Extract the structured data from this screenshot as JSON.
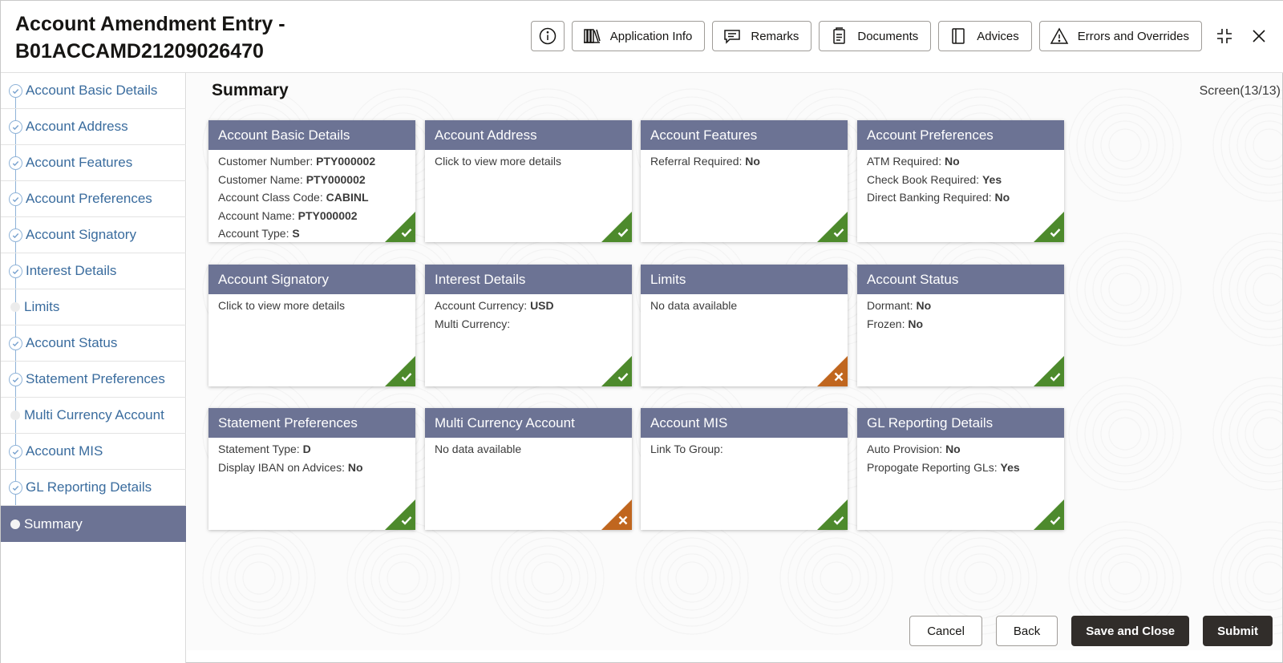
{
  "header": {
    "title_line1": "Account Amendment Entry -",
    "title_line2": "B01ACCAMD21209026470",
    "toolbar": {
      "info_icon": "info-icon",
      "application_info": "Application Info",
      "remarks": "Remarks",
      "documents": "Documents",
      "advices": "Advices",
      "errors_and_overrides": "Errors and Overrides"
    }
  },
  "sidebar": {
    "items": [
      {
        "label": "Account Basic Details",
        "status": "visited"
      },
      {
        "label": "Account Address",
        "status": "visited"
      },
      {
        "label": "Account Features",
        "status": "visited"
      },
      {
        "label": "Account Preferences",
        "status": "visited"
      },
      {
        "label": "Account Signatory",
        "status": "visited"
      },
      {
        "label": "Interest Details",
        "status": "visited"
      },
      {
        "label": "Limits",
        "status": "not-visited"
      },
      {
        "label": "Account Status",
        "status": "visited"
      },
      {
        "label": "Statement Preferences",
        "status": "visited"
      },
      {
        "label": "Multi Currency Account",
        "status": "not-visited"
      },
      {
        "label": "Account MIS",
        "status": "visited"
      },
      {
        "label": "GL Reporting Details",
        "status": "visited"
      },
      {
        "label": "Summary",
        "status": "active"
      }
    ]
  },
  "main": {
    "title": "Summary",
    "screen_indicator": "Screen(13/13)",
    "cards": [
      {
        "title": "Account Basic Details",
        "status": "ok",
        "rows": [
          {
            "label": "Customer Number: ",
            "value": "PTY000002"
          },
          {
            "label": "Customer Name: ",
            "value": "PTY000002"
          },
          {
            "label": "Account Class Code: ",
            "value": "CABINL"
          },
          {
            "label": "Account Name: ",
            "value": "PTY000002"
          },
          {
            "label": "Account Type: ",
            "value": "S"
          }
        ]
      },
      {
        "title": "Account Address",
        "status": "ok",
        "rows": [
          {
            "label": "Click to view more details",
            "value": ""
          }
        ]
      },
      {
        "title": "Account Features",
        "status": "ok",
        "rows": [
          {
            "label": "Referral Required: ",
            "value": "No"
          }
        ]
      },
      {
        "title": "Account Preferences",
        "status": "ok",
        "rows": [
          {
            "label": "ATM Required: ",
            "value": "No"
          },
          {
            "label": "Check Book Required: ",
            "value": "Yes"
          },
          {
            "label": "Direct Banking Required: ",
            "value": "No"
          }
        ]
      },
      {
        "title": "Account Signatory",
        "status": "ok",
        "rows": [
          {
            "label": "Click to view more details",
            "value": ""
          }
        ]
      },
      {
        "title": "Interest Details",
        "status": "ok",
        "rows": [
          {
            "label": "Account Currency: ",
            "value": "USD"
          },
          {
            "label": "Multi Currency: ",
            "value": ""
          }
        ]
      },
      {
        "title": "Limits",
        "status": "error",
        "rows": [
          {
            "label": "No data available",
            "value": ""
          }
        ]
      },
      {
        "title": "Account Status",
        "status": "ok",
        "rows": [
          {
            "label": "Dormant: ",
            "value": "No"
          },
          {
            "label": "Frozen: ",
            "value": "No"
          }
        ]
      },
      {
        "title": "Statement Preferences",
        "status": "ok",
        "rows": [
          {
            "label": "Statement Type: ",
            "value": "D"
          },
          {
            "label": "Display IBAN on Advices: ",
            "value": "No"
          }
        ]
      },
      {
        "title": "Multi Currency Account",
        "status": "error",
        "rows": [
          {
            "label": "No data available",
            "value": ""
          }
        ]
      },
      {
        "title": "Account MIS",
        "status": "ok",
        "rows": [
          {
            "label": "Link To Group: ",
            "value": ""
          }
        ]
      },
      {
        "title": "GL Reporting Details",
        "status": "ok",
        "rows": [
          {
            "label": "Auto Provision: ",
            "value": "No"
          },
          {
            "label": "Propogate Reporting GLs: ",
            "value": "Yes"
          }
        ]
      }
    ]
  },
  "footer": {
    "cancel": "Cancel",
    "back": "Back",
    "save_and_close": "Save and Close",
    "submit": "Submit"
  },
  "colors": {
    "card_header": "#6c7394",
    "ok_corner": "#4d8a2c",
    "error_corner": "#c0661f",
    "sidebar_link": "#3a6c9e",
    "primary_button": "#312d2a"
  }
}
